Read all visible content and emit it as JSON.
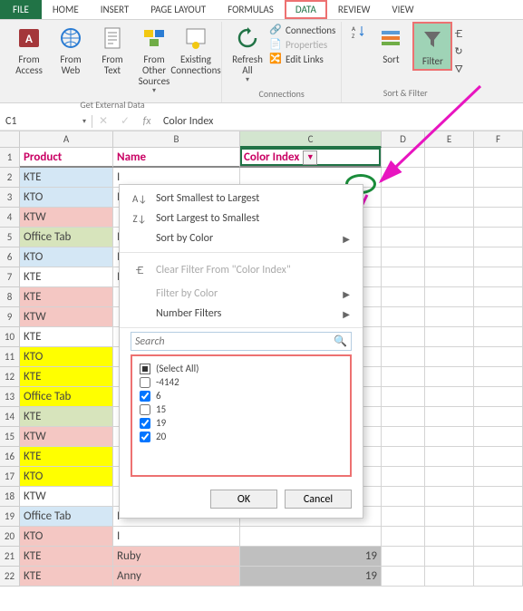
{
  "tabs": {
    "file": "FILE",
    "home": "HOME",
    "insert": "INSERT",
    "pagelayout": "PAGE LAYOUT",
    "formulas": "FORMULAS",
    "data": "DATA",
    "review": "REVIEW",
    "view": "VIEW"
  },
  "ribbon": {
    "ext": {
      "access": "From Access",
      "web": "From Web",
      "text": "From Text",
      "other": "From Other Sources",
      "existing": "Existing Connections",
      "label": "Get External Data"
    },
    "conn": {
      "refresh": "Refresh All",
      "connections": "Connections",
      "properties": "Properties",
      "editlinks": "Edit Links",
      "label": "Connections"
    },
    "sf": {
      "sort": "Sort",
      "filter": "Filter",
      "label": "Sort & Filter"
    }
  },
  "namebox": "C1",
  "formula": "Color Index",
  "fx": "fx",
  "ok": "OK",
  "cancel": "Cancel",
  "columns": [
    "A",
    "B",
    "C",
    "D",
    "E",
    "F"
  ],
  "headers": {
    "a": "Product",
    "b": "Name",
    "c": "Color Index"
  },
  "rows": [
    {
      "n": "1"
    },
    {
      "n": "2",
      "a": "KTE",
      "b": "I",
      "ca": "fill-blue"
    },
    {
      "n": "3",
      "a": "KTO",
      "b": "I",
      "ca": "fill-blue"
    },
    {
      "n": "4",
      "a": "KTW",
      "b": "",
      "ca": "fill-pink"
    },
    {
      "n": "5",
      "a": "Office Tab",
      "b": "I",
      "ca": "fill-green"
    },
    {
      "n": "6",
      "a": "KTO",
      "b": "I",
      "ca": "fill-blue"
    },
    {
      "n": "7",
      "a": "KTE",
      "b": "I",
      "ca": "fill-none"
    },
    {
      "n": "8",
      "a": "KTE",
      "b": "",
      "ca": "fill-pink"
    },
    {
      "n": "9",
      "a": "KTW",
      "b": "",
      "ca": "fill-pink"
    },
    {
      "n": "10",
      "a": "KTE",
      "b": "",
      "ca": "fill-none"
    },
    {
      "n": "11",
      "a": "KTO",
      "b": "",
      "ca": "fill-yellow"
    },
    {
      "n": "12",
      "a": "KTE",
      "b": "",
      "ca": "fill-yellow"
    },
    {
      "n": "13",
      "a": "Office Tab",
      "b": "",
      "ca": "fill-yellow"
    },
    {
      "n": "14",
      "a": "KTE",
      "b": "",
      "ca": "fill-green"
    },
    {
      "n": "15",
      "a": "KTW",
      "b": "",
      "ca": "fill-pink"
    },
    {
      "n": "16",
      "a": "KTE",
      "b": "",
      "ca": "fill-yellow"
    },
    {
      "n": "17",
      "a": "KTO",
      "b": "",
      "ca": "fill-yellow"
    },
    {
      "n": "18",
      "a": "KTW",
      "b": "",
      "ca": "fill-none"
    },
    {
      "n": "19",
      "a": "Office Tab",
      "b": "I",
      "ca": "fill-blue"
    },
    {
      "n": "20",
      "a": "KTO",
      "b": "I",
      "ca": "fill-pink"
    },
    {
      "n": "21",
      "a": "KTE",
      "b": "Ruby",
      "c": "19",
      "ca": "fill-pink",
      "cb": "fill-pink",
      "sel": true
    },
    {
      "n": "22",
      "a": "KTE",
      "b": "Anny",
      "c": "19",
      "ca": "fill-pink",
      "cb": "fill-pink",
      "sel": true
    }
  ],
  "popup": {
    "sortAsc": "Sort Smallest to Largest",
    "sortDesc": "Sort Largest to Smallest",
    "sortColor": "Sort by Color",
    "clear": "Clear Filter From \"Color Index\"",
    "filterColor": "Filter by Color",
    "numFilters": "Number Filters",
    "search": "Search",
    "items": [
      {
        "label": "(Select All)",
        "checked": "partial"
      },
      {
        "label": "-4142",
        "checked": false
      },
      {
        "label": "6",
        "checked": true
      },
      {
        "label": "15",
        "checked": false
      },
      {
        "label": "19",
        "checked": true
      },
      {
        "label": "20",
        "checked": true
      }
    ]
  }
}
